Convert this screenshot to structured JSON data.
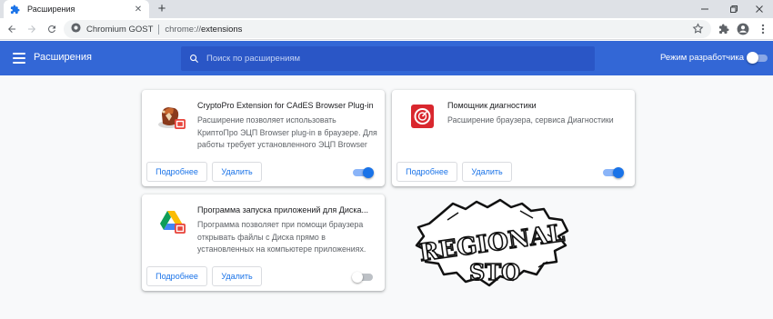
{
  "tab": {
    "title": "Расширения",
    "icon": "puzzle-icon"
  },
  "toolbar": {
    "site_name": "Chromium GOST",
    "url_scheme": "chrome://",
    "url_host": "extensions"
  },
  "header": {
    "title": "Расширения",
    "search_placeholder": "Поиск по расширениям",
    "dev_mode_label": "Режим разработчика",
    "dev_mode_enabled": false
  },
  "colors": {
    "accent": "#3367d6",
    "link": "#1a73e8"
  },
  "extensions": [
    {
      "name": "CryptoPro Extension for CAdES Browser Plug-in",
      "description": "Расширение позволяет использовать КриптоПро ЭЦП Browser plug-in в браузере. Для работы требует установленного ЭЦП Browser",
      "details_label": "Подробнее",
      "remove_label": "Удалить",
      "enabled": true,
      "icon": "cryptopro-icon"
    },
    {
      "name": "Помощник диагностики",
      "description": "Расширение браузера, сервиса Диагностики",
      "details_label": "Подробнее",
      "remove_label": "Удалить",
      "enabled": true,
      "icon": "diagnostics-icon"
    },
    {
      "name": "Программа запуска приложений для Диска...",
      "description": "Программа позволяет при помощи браузера открывать файлы с Диска прямо в установленных на компьютере приложениях.",
      "details_label": "Подробнее",
      "remove_label": "Удалить",
      "enabled": false,
      "icon": "google-drive-icon"
    }
  ],
  "watermark": {
    "line1": "REGIONAL",
    "line2": "STO"
  }
}
